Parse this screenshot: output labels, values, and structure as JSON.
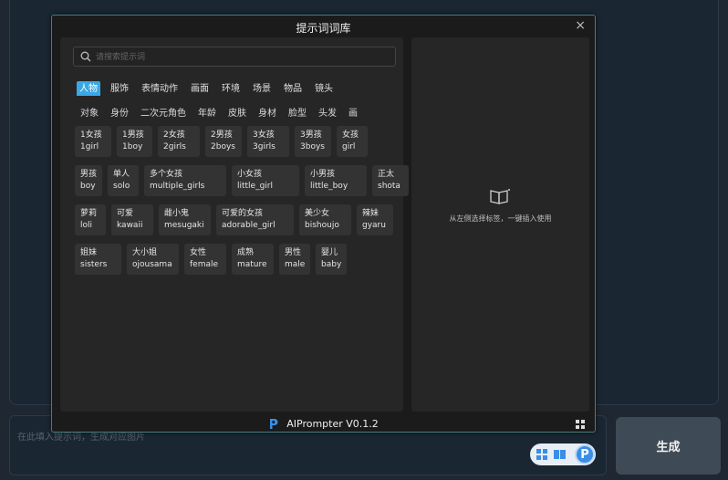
{
  "background": {
    "prompt_placeholder": "在此填入提示词，生成对应图片",
    "generate_label": "生成"
  },
  "modal": {
    "title": "提示词词库",
    "close": "×",
    "footer": "AIPrompter V0.1.2",
    "search_placeholder": "请搜索提示词",
    "categories": [
      "人物",
      "服饰",
      "表情动作",
      "画面",
      "环境",
      "场景",
      "物品",
      "镜头"
    ],
    "active_category": 0,
    "subcategories": [
      "对象",
      "身份",
      "二次元角色",
      "年龄",
      "皮肤",
      "身材",
      "脸型",
      "头发",
      "画"
    ],
    "active_subcategory": 0,
    "tag_rows": [
      [
        {
          "zh": "1女孩",
          "en": "1girl"
        },
        {
          "zh": "1男孩",
          "en": "1boy"
        },
        {
          "zh": "2女孩",
          "en": "2girls"
        },
        {
          "zh": "2男孩",
          "en": "2boys"
        },
        {
          "zh": "3女孩",
          "en": "3girls"
        },
        {
          "zh": "3男孩",
          "en": "3boys"
        },
        {
          "zh": "女孩",
          "en": "girl"
        }
      ],
      [
        {
          "zh": "男孩",
          "en": "boy"
        },
        {
          "zh": "单人",
          "en": "solo"
        },
        {
          "zh": "多个女孩",
          "en": "multiple_girls"
        },
        {
          "zh": "小女孩",
          "en": "little_girl"
        },
        {
          "zh": "小男孩",
          "en": "little_boy"
        },
        {
          "zh": "正太",
          "en": "shota"
        }
      ],
      [
        {
          "zh": "萝莉",
          "en": "loli"
        },
        {
          "zh": "可爱",
          "en": "kawaii"
        },
        {
          "zh": "雌小鬼",
          "en": "mesugaki"
        },
        {
          "zh": "可爱的女孩",
          "en": "adorable_girl"
        },
        {
          "zh": "美少女",
          "en": "bishoujo"
        },
        {
          "zh": "辣妹",
          "en": "gyaru"
        }
      ],
      [
        {
          "zh": "姐妹",
          "en": "sisters"
        },
        {
          "zh": "大小姐",
          "en": "ojousama"
        },
        {
          "zh": "女性",
          "en": "female"
        },
        {
          "zh": "成熟",
          "en": "mature"
        },
        {
          "zh": "男性",
          "en": "male"
        },
        {
          "zh": "婴儿",
          "en": "baby"
        }
      ]
    ],
    "right_empty_text": "从左侧选择标签，一键插入使用"
  },
  "colors": {
    "accent": "#3aa8e6",
    "tag_bg": "#333333",
    "modal_border": "#4a7d7a"
  }
}
